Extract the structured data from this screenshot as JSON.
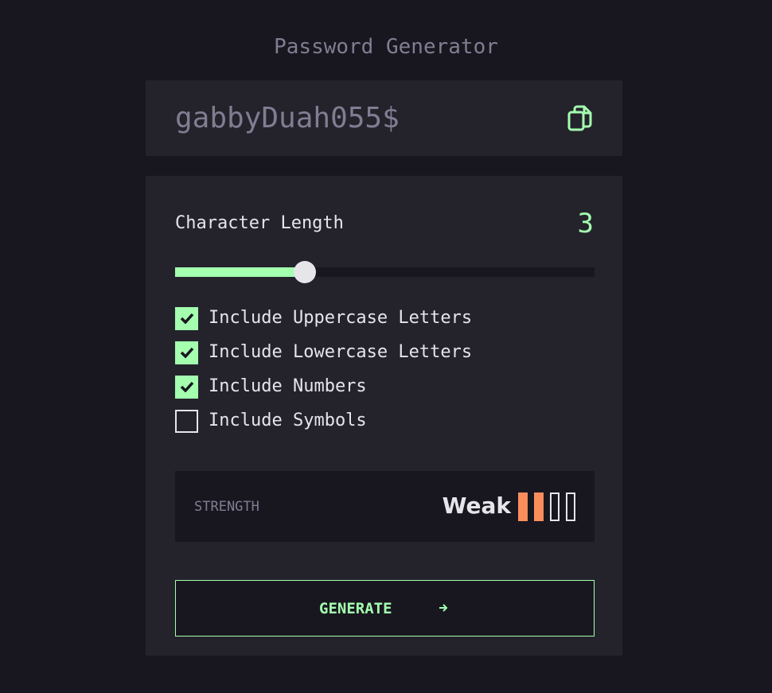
{
  "app": {
    "title": "Password Generator"
  },
  "password": {
    "value": "gabbyDuah055$"
  },
  "icons": {
    "copy": "copy-icon",
    "check": "check-icon",
    "arrow": "arrow-right-icon"
  },
  "length": {
    "label": "Character Length",
    "value": "3",
    "min": 0,
    "max": 10,
    "current": 3.1
  },
  "options": [
    {
      "label": "Include Uppercase Letters",
      "checked": true
    },
    {
      "label": "Include Lowercase Letters",
      "checked": true
    },
    {
      "label": "Include Numbers",
      "checked": true
    },
    {
      "label": "Include Symbols",
      "checked": false
    }
  ],
  "strength": {
    "label": "STRENGTH",
    "value": "Weak",
    "level": 2,
    "levels": 4
  },
  "generate": {
    "label": "GENERATE"
  },
  "colors": {
    "accent": "#a4ffaf",
    "bg": "#18171f",
    "panel": "#24232c",
    "weak": "#f98e5c",
    "text": "#e6e5ea",
    "muted": "#817d92"
  }
}
